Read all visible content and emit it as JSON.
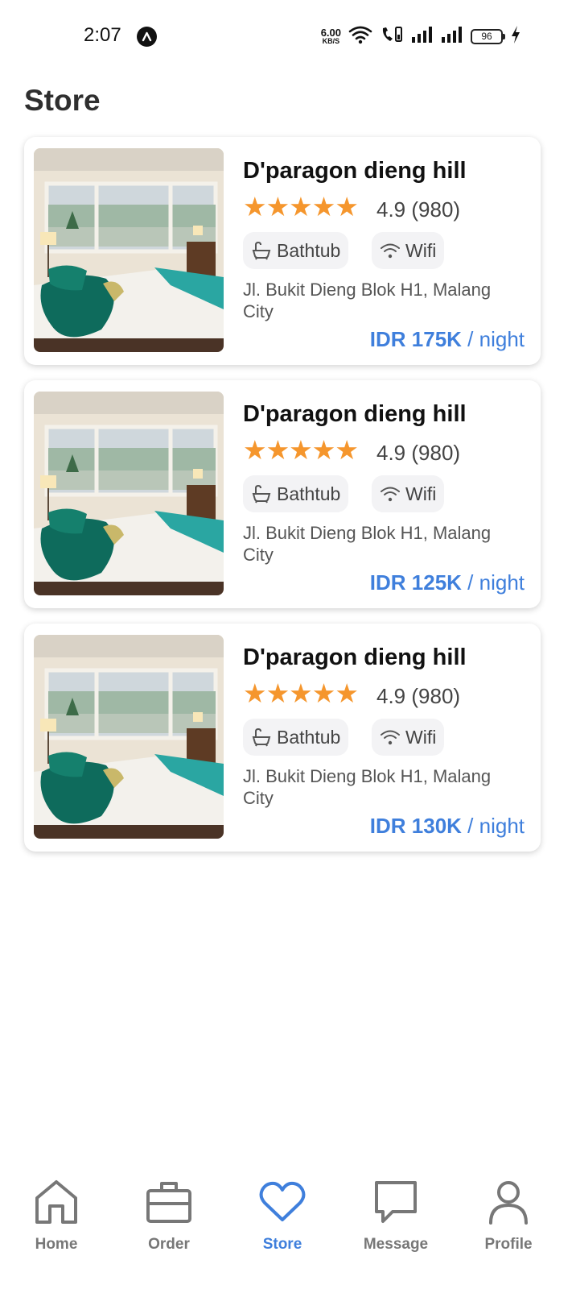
{
  "status_bar": {
    "time": "2:07",
    "net_speed_value": "6.00",
    "net_speed_unit": "KB/S",
    "battery": "96"
  },
  "page": {
    "title": "Store"
  },
  "listings": [
    {
      "name": "D'paragon dieng hill",
      "stars": "★★★★★",
      "rating": "4.9 (980)",
      "amenities": [
        "Bathtub",
        "Wifi"
      ],
      "address": "Jl. Bukit Dieng Blok H1, Malang City",
      "price": "IDR 175K",
      "price_unit": "/ night"
    },
    {
      "name": "D'paragon dieng hill",
      "stars": "★★★★★",
      "rating": "4.9 (980)",
      "amenities": [
        "Bathtub",
        "Wifi"
      ],
      "address": "Jl. Bukit Dieng Blok H1, Malang City",
      "price": "IDR 125K",
      "price_unit": "/ night"
    },
    {
      "name": "D'paragon dieng hill",
      "stars": "★★★★★",
      "rating": "4.9 (980)",
      "amenities": [
        "Bathtub",
        "Wifi"
      ],
      "address": "Jl. Bukit Dieng Blok H1, Malang City",
      "price": "IDR 130K",
      "price_unit": "/ night"
    }
  ],
  "bottom_nav": {
    "items": [
      {
        "label": "Home",
        "icon": "home-icon",
        "active": false
      },
      {
        "label": "Order",
        "icon": "briefcase-icon",
        "active": false
      },
      {
        "label": "Store",
        "icon": "heart-icon",
        "active": true
      },
      {
        "label": "Message",
        "icon": "chat-icon",
        "active": false
      },
      {
        "label": "Profile",
        "icon": "user-icon",
        "active": false
      }
    ]
  },
  "colors": {
    "accent": "#3f7fdc",
    "star": "#f5962d",
    "inactive_nav": "#777777"
  }
}
